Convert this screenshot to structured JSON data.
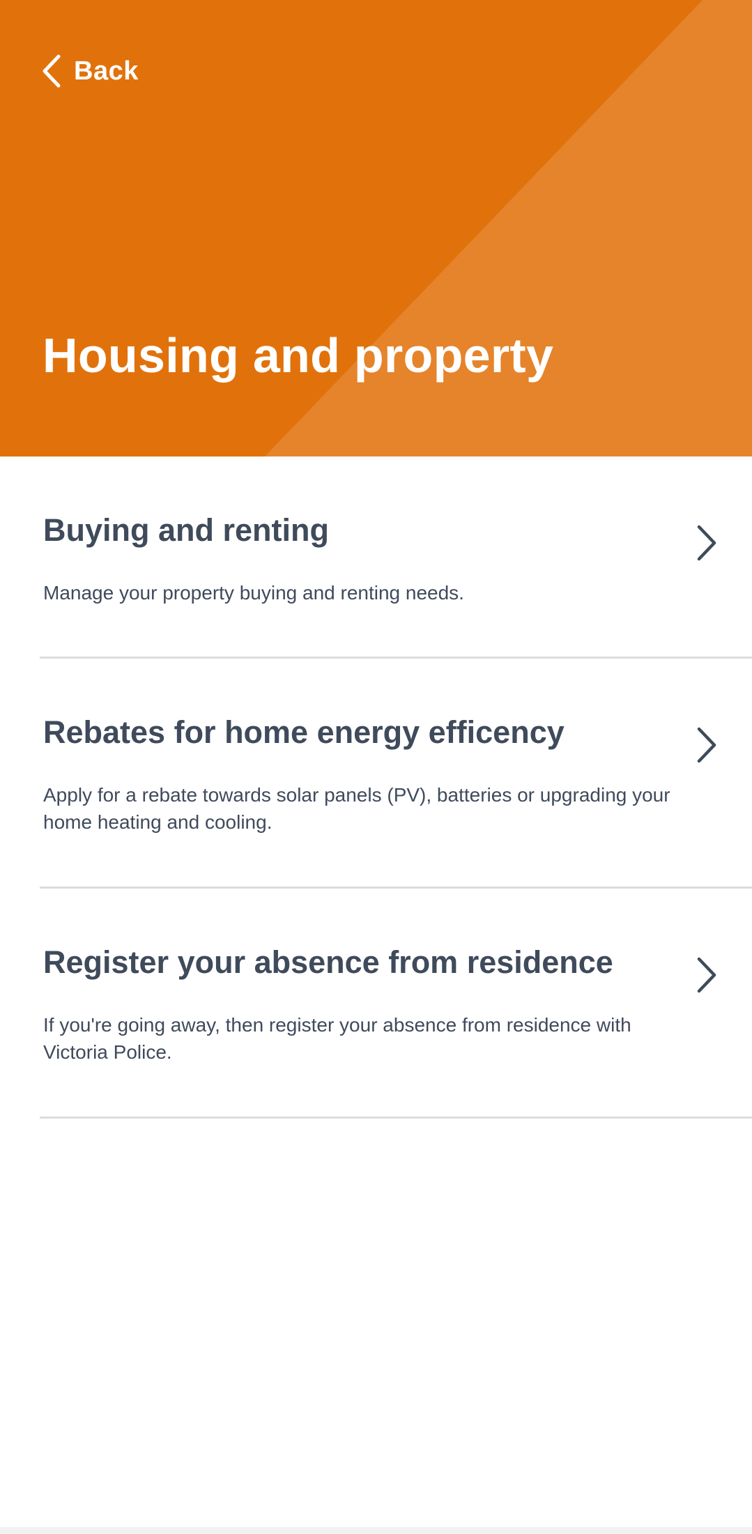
{
  "header": {
    "back_label": "Back",
    "title": "Housing and property",
    "background_color": "#e1720b",
    "accent_color": "#e5842b"
  },
  "items": [
    {
      "title": "Buying and renting",
      "description": "Manage your property buying and renting needs.",
      "icon": "chevron-right-icon"
    },
    {
      "title": "Rebates for home energy efficency",
      "description": "Apply for a rebate towards solar panels (PV), batteries or upgrading your home heating and cooling.",
      "icon": "chevron-right-icon"
    },
    {
      "title": "Register your absence from residence",
      "description": "If you're going away, then register your absence from residence with Victoria Police.",
      "icon": "chevron-right-icon"
    }
  ],
  "colors": {
    "text": "#3f4a5b",
    "divider": "#dcdcdc"
  }
}
